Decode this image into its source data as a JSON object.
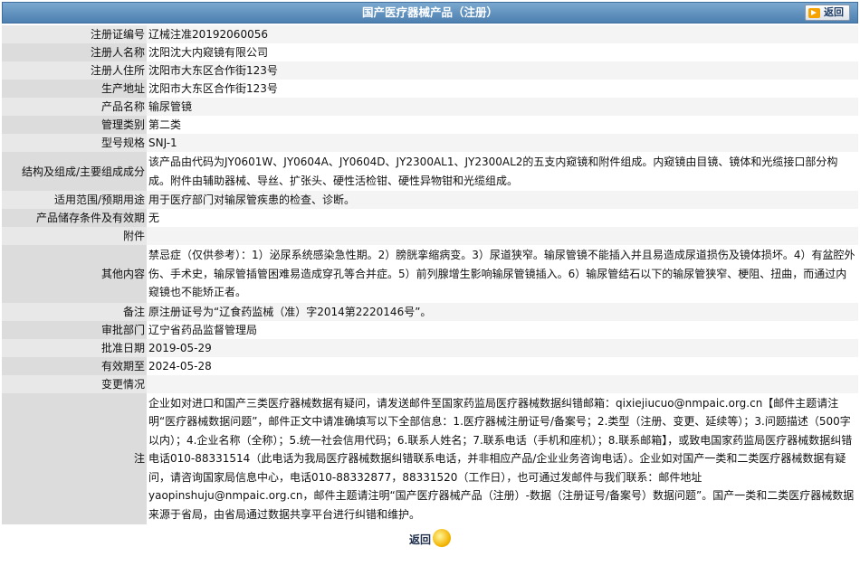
{
  "header": {
    "title": "国产医疗器械产品（注册）",
    "back_label": "返回"
  },
  "record": [
    {
      "label": "注册证编号",
      "value": "辽械注准20192060056"
    },
    {
      "label": "注册人名称",
      "value": "沈阳沈大内窥镜有限公司"
    },
    {
      "label": "注册人住所",
      "value": "沈阳市大东区合作街123号"
    },
    {
      "label": "生产地址",
      "value": "沈阳市大东区合作街123号"
    },
    {
      "label": "产品名称",
      "value": "输尿管镜"
    },
    {
      "label": "管理类别",
      "value": "第二类"
    },
    {
      "label": "型号规格",
      "value": "SNJ-1"
    },
    {
      "label": "结构及组成/主要组成成分",
      "value": "该产品由代码为JY0601W、JY0604A、JY0604D、JY2300AL1、JY2300AL2的五支内窥镜和附件组成。内窥镜由目镜、镜体和光缆接口部分构成。附件由辅助器械、导丝、扩张头、硬性活检钳、硬性异物钳和光缆组成。"
    },
    {
      "label": "适用范围/预期用途",
      "value": "用于医疗部门对输尿管疾患的检查、诊断。"
    },
    {
      "label": "产品储存条件及有效期",
      "value": "无"
    },
    {
      "label": "附件",
      "value": ""
    },
    {
      "label": "其他内容",
      "value": "禁忌症（仅供参考）：1）泌尿系统感染急性期。2）膀胱挛缩病变。3）尿道狭窄。输尿管镜不能插入并且易造成尿道损伤及镜体损坏。4）有盆腔外伤、手术史，输尿管插管困难易造成穿孔等合并症。5）前列腺增生影响输尿管镜插入。6）输尿管结石以下的输尿管狭窄、梗阻、扭曲，而通过内窥镜也不能矫正者。"
    },
    {
      "label": "备注",
      "value": "原注册证号为“辽食药监械（准）字2014第2220146号”。"
    },
    {
      "label": "审批部门",
      "value": "辽宁省药品监督管理局"
    },
    {
      "label": "批准日期",
      "value": "2019-05-29"
    },
    {
      "label": "有效期至",
      "value": "2024-05-28"
    },
    {
      "label": "变更情况",
      "value": ""
    },
    {
      "label": "注",
      "value": "企业如对进口和国产三类医疗器械数据有疑问，请发送邮件至国家药监局医疗器械数据纠错邮箱：qixiejiucuo@nmpaic.org.cn【邮件主题请注明“医疗器械数据问题”，邮件正文中请准确填写以下全部信息：1.医疗器械注册证号/备案号；2.类型（注册、变更、延续等）；3.问题描述（500字以内）；4.企业名称（全称）；5.统一社会信用代码；6.联系人姓名；7.联系电话（手机和座机）；8.联系邮箱】，或致电国家药监局医疗器械数据纠错电话010-88331514（此电话为我局医疗器械数据纠错联系电话，并非相应产品/企业业务咨询电话）。企业如对国产一类和二类医疗器械数据有疑问，请咨询国家局信息中心，电话010-88332877，88331520（工作日），也可通过发邮件与我们联系：邮件地址yaopinshuju@nmpaic.org.cn，邮件主题请注明“国产医疗器械产品（注册）-数据（注册证号/备案号）数据问题”。国产一类和二类医疗器械数据来源于省局，由省局通过数据共享平台进行纠错和维护。"
    }
  ],
  "footer": {
    "back_label": "返回"
  }
}
